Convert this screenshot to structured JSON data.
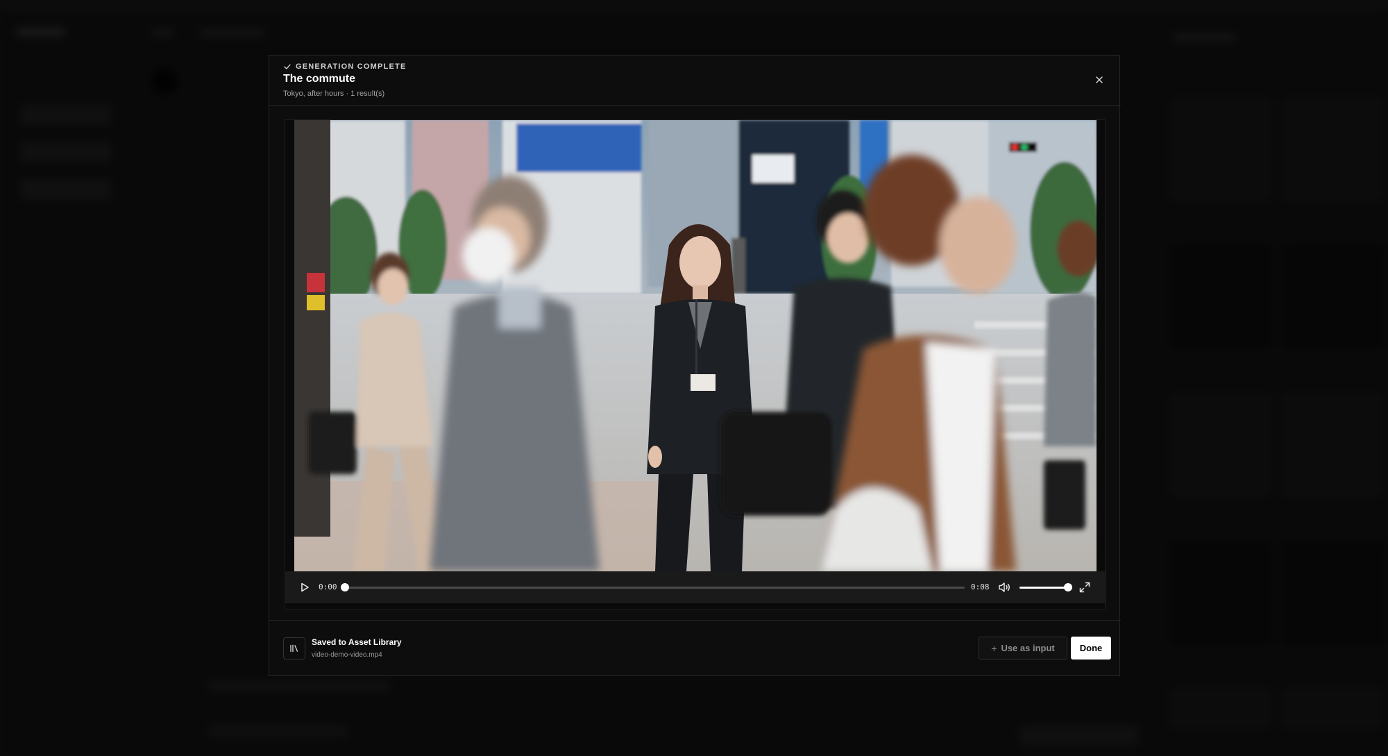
{
  "modal": {
    "status": "GENERATION COMPLETE",
    "title": "The commute",
    "subtitle": "Tokyo, after hours · 1 result(s)",
    "close_icon": "close-icon"
  },
  "player": {
    "current_time": "0:00",
    "duration": "0:08",
    "progress": 0.0,
    "volume": 1.0,
    "icons": {
      "play": "play-icon",
      "volume": "volume-icon",
      "fullscreen": "fullscreen-icon"
    }
  },
  "footer": {
    "saved_title": "Saved to Asset Library",
    "file_name": "video-demo-video.mp4",
    "library_icon": "library-icon",
    "use_input_label": "Use as input",
    "use_input_icon": "plus-icon",
    "done_label": "Done"
  },
  "colors": {
    "modal_bg": "#0d0d0d",
    "controls_bg": "#1a1a1a",
    "primary_button_bg": "#ffffff"
  }
}
